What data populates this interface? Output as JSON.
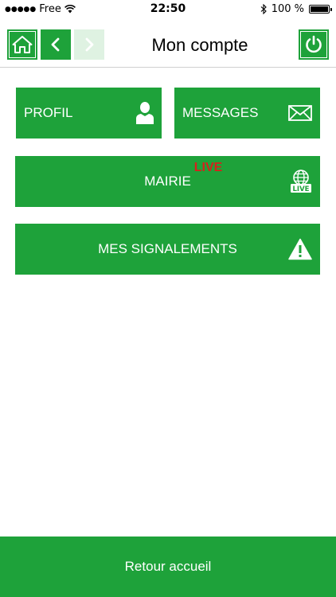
{
  "status_bar": {
    "carrier": "Free",
    "time": "22:50",
    "battery": "100 %"
  },
  "header": {
    "title": "Mon compte",
    "icons": {
      "home": "home-icon",
      "back": "chevron-left-icon",
      "forward": "chevron-right-icon",
      "power": "power-icon"
    }
  },
  "tiles": {
    "profil": {
      "label": "PROFIL",
      "icon": "user-icon"
    },
    "messages": {
      "label": "MESSAGES",
      "icon": "envelope-icon"
    },
    "mairie": {
      "label": "MAIRIE",
      "badge": "LIVE",
      "icon": "globe-live-icon",
      "icon_text": "LIVE"
    },
    "signalements": {
      "label": "MES SIGNALEMENTS",
      "icon": "warning-icon"
    }
  },
  "footer": {
    "label": "Retour accueil"
  },
  "colors": {
    "primary": "#1ea23a",
    "disabled": "#dff2e2",
    "live": "#d8201c"
  }
}
